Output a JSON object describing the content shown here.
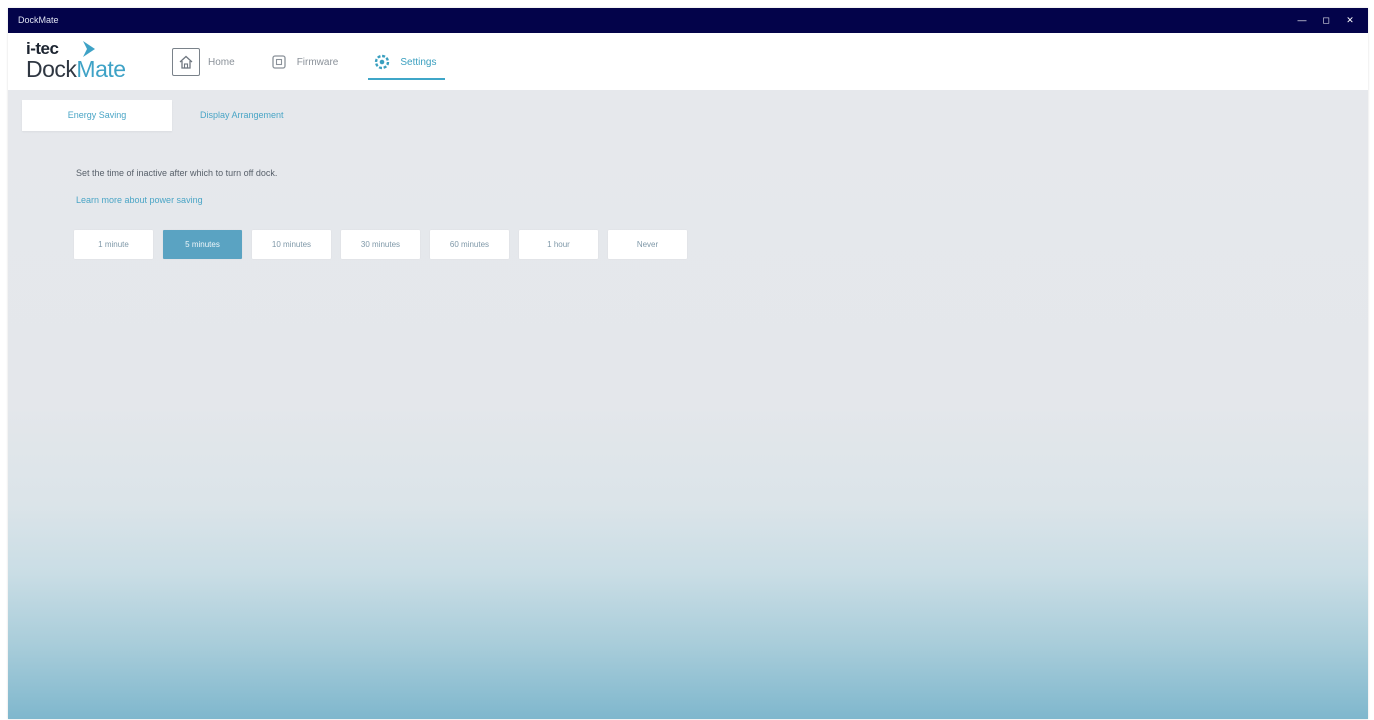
{
  "window": {
    "title": "DockMate",
    "controls": [
      "—",
      "◻",
      "✕"
    ]
  },
  "logo": {
    "top": "i-tec",
    "bottom_dark": "Dock",
    "bottom_accent": "Mate"
  },
  "nav": {
    "home_label": "Home",
    "firmware_label": "Firmware",
    "settings_label": "Settings"
  },
  "tabs": {
    "active": "Energy Saving",
    "inactive": "Display Arrangement"
  },
  "settings": {
    "description": "Set the time of inactive after which to turn off dock.",
    "link": "Learn more about power saving",
    "options": [
      "1 minute",
      "5 minutes",
      "10 minutes",
      "30 minutes",
      "60 minutes",
      "1 hour",
      "Never"
    ],
    "selected_index": 1
  },
  "colors": {
    "titlebar": "#03034a",
    "accent": "#3ea2c6",
    "selected_option": "#5aa3c2"
  }
}
